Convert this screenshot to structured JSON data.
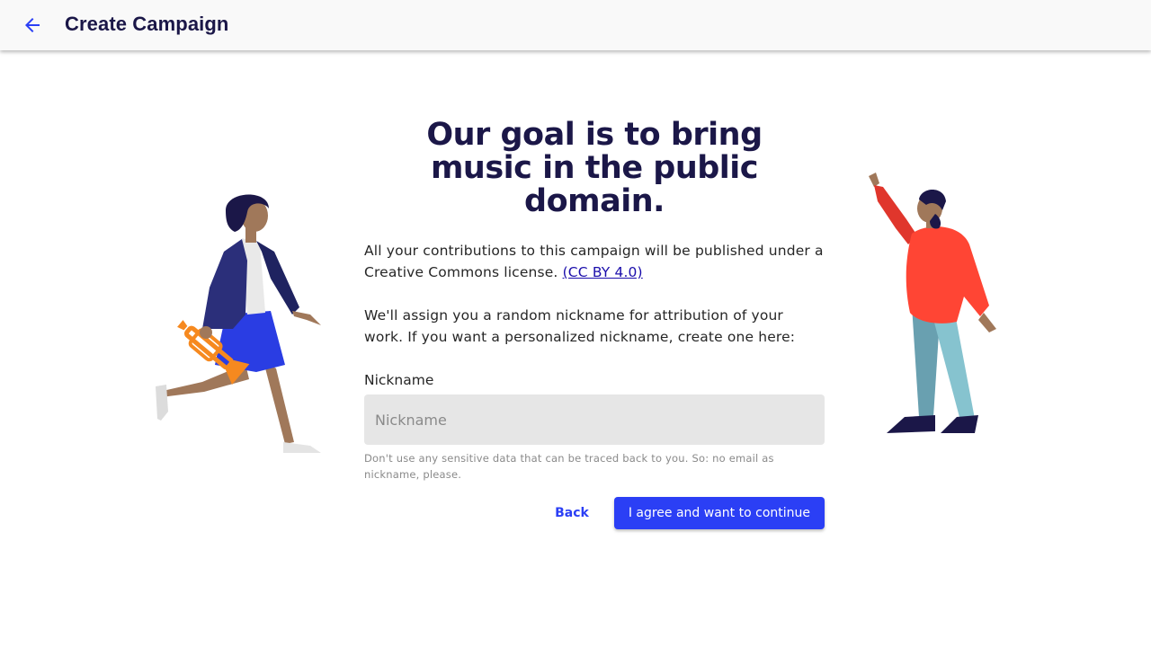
{
  "app_bar": {
    "back_icon": "arrow-left-icon",
    "title": "Create Campaign"
  },
  "headline": "Our goal is to bring music in the public domain.",
  "intro": {
    "text": "All your contributions to this campaign will be published under a Creative Commons license.",
    "link_text": "(CC BY 4.0)"
  },
  "nickname_info": "We'll assign you a random nickname for attribution of your work. If you want a personalized nickname, create one here:",
  "nickname_field": {
    "label": "Nickname",
    "placeholder": "Nickname",
    "value": "",
    "helper": "Don't use any sensitive data that can be traced back to you. So: no email as nickname, please."
  },
  "actions": {
    "back_label": "Back",
    "continue_label": "I agree and want to continue"
  },
  "colors": {
    "primary": "#2b3ff5",
    "title": "#1b1748",
    "field_bg": "#e6e6e6"
  }
}
